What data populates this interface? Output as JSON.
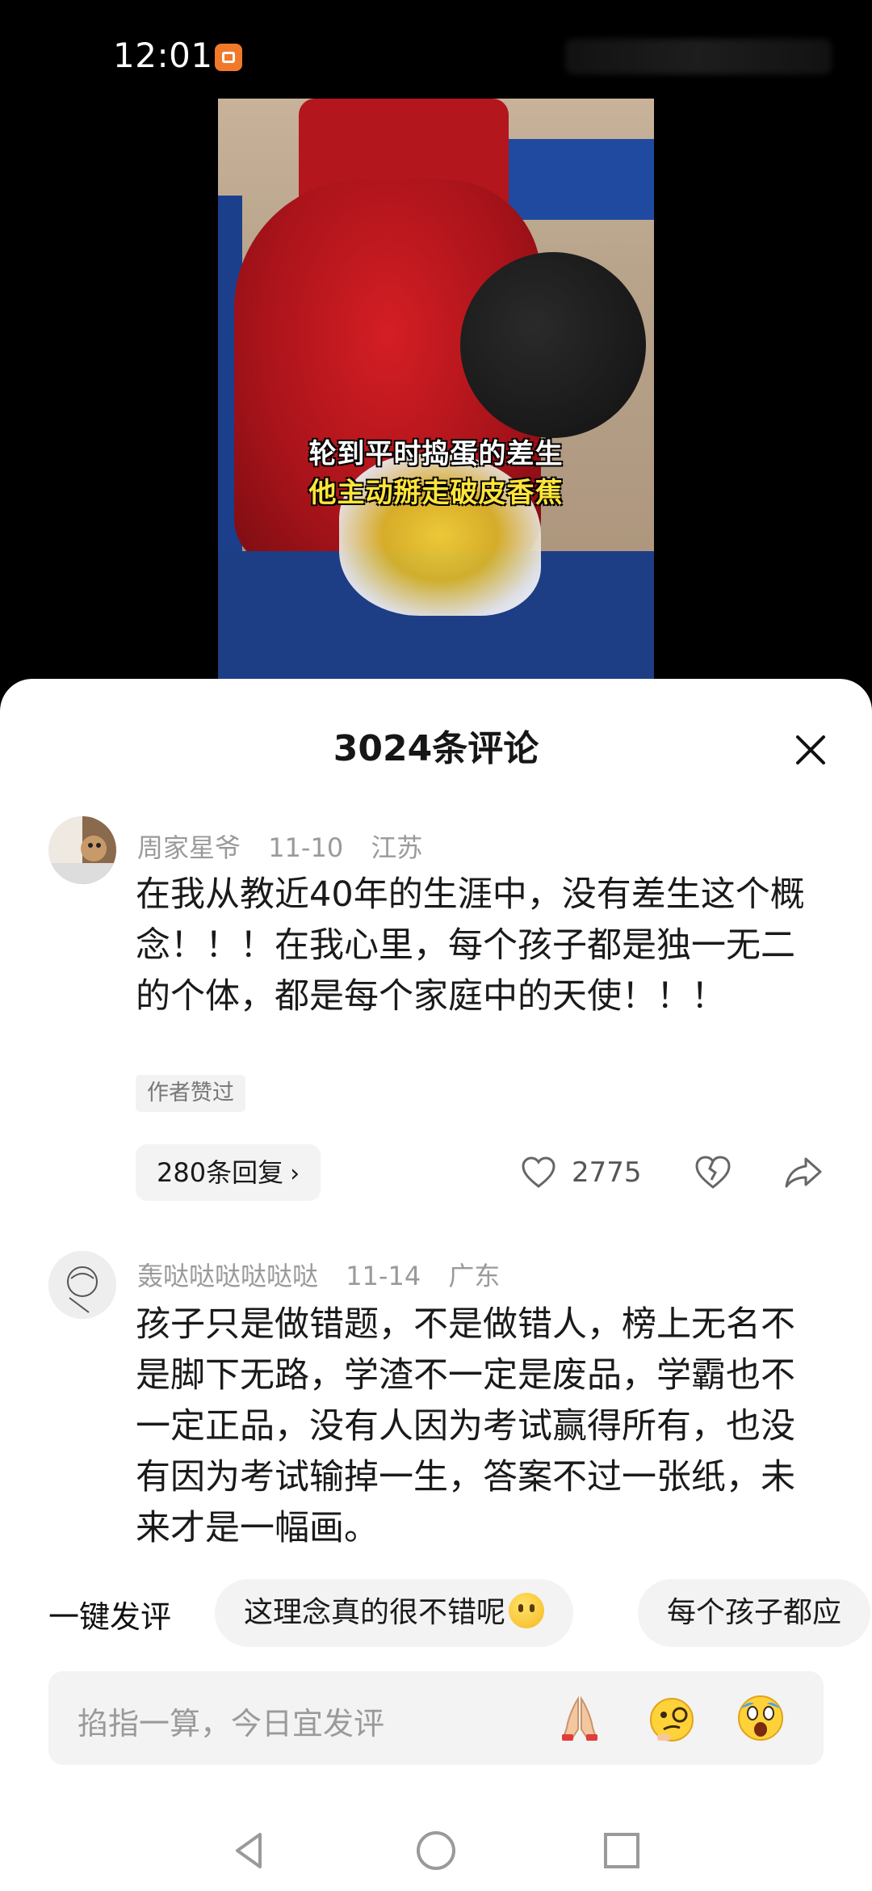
{
  "status_bar": {
    "time": "12:01"
  },
  "video": {
    "caption_line1": "轮到平时捣蛋的差生",
    "caption_line2": "他主动掰走破皮香蕉"
  },
  "comments_sheet": {
    "title": "3024条评论",
    "comments": [
      {
        "author": "周家星爷",
        "date": "11-10",
        "location": "江苏",
        "text": "在我从教近40年的生涯中，没有差生这个概念！！！在我心里，每个孩子都是独一无二的个体，都是每个家庭中的天使！！！",
        "author_liked": "作者赞过",
        "replies_label": "280条回复",
        "like_count": "2775"
      },
      {
        "author": "轰哒哒哒哒哒哒",
        "date": "11-14",
        "location": "广东",
        "text": "孩子只是做错题，不是做错人，榜上无名不是脚下无路，学渣不一定是废品，学霸也不一定正品，没有人因为考试赢得所有，也没有因为考试输掉一生，答案不过一张纸，未来才是一幅画。"
      }
    ],
    "quick_comment": {
      "label": "一键发评",
      "chips": [
        "这理念真的很不错呢",
        "每个孩子都应"
      ]
    },
    "input": {
      "placeholder": "掐指一算，今日宜发评",
      "emojis": [
        "praying-hands-emoji",
        "smirking-monocle-emoji",
        "screaming-emoji"
      ]
    }
  },
  "nav_bar": {
    "buttons": [
      "back-icon",
      "home-icon",
      "recents-icon"
    ]
  }
}
